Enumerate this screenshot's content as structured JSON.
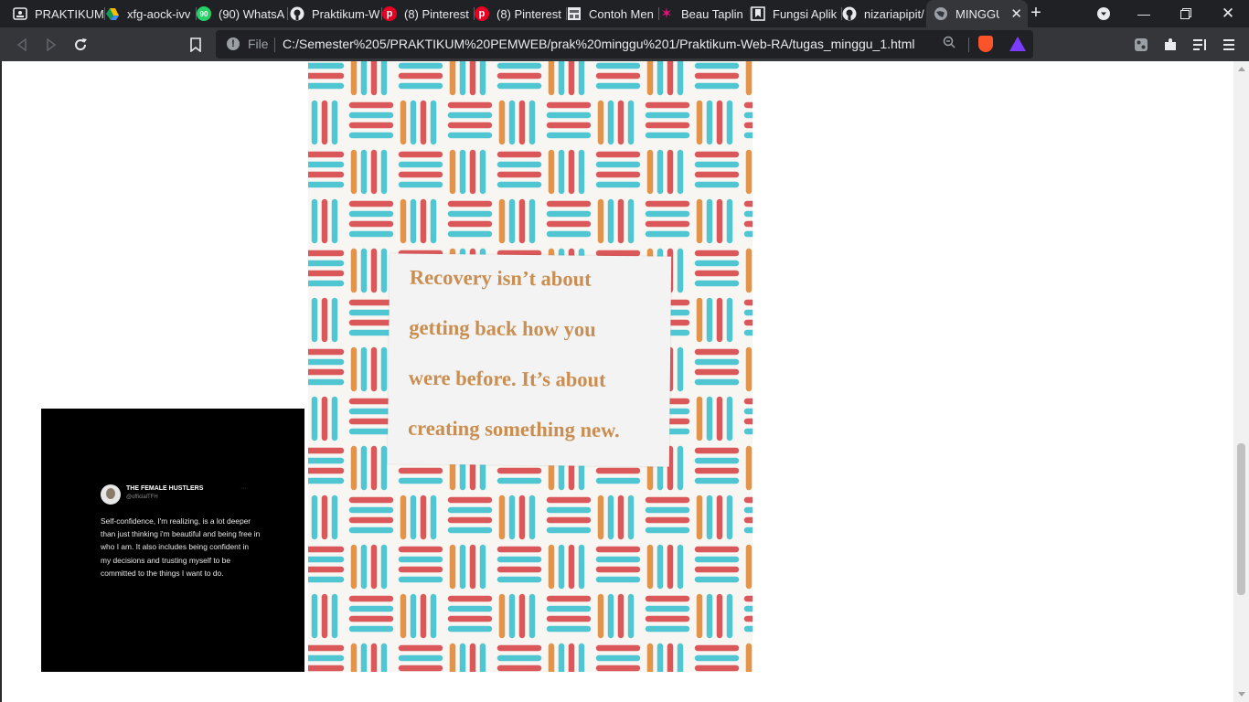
{
  "browser": {
    "tabs": [
      {
        "label": "PRAKTIKUM",
        "icon": "contact-icon"
      },
      {
        "label": "xfg-aock-ivv",
        "icon": "google-drive-icon"
      },
      {
        "label": "(90) WhatsA",
        "icon": "whatsapp-icon"
      },
      {
        "label": "Praktikum-W",
        "icon": "github-icon"
      },
      {
        "label": "(8) Pinterest",
        "icon": "pinterest-icon"
      },
      {
        "label": "(8) Pinterest",
        "icon": "pinterest-icon"
      },
      {
        "label": "Contoh Men",
        "icon": "page-icon"
      },
      {
        "label": "Beau Taplin",
        "icon": "star-icon"
      },
      {
        "label": "Fungsi Aplik",
        "icon": "bookmark-page-icon"
      },
      {
        "label": "nizariapipit/",
        "icon": "github-icon"
      },
      {
        "label": "MINGGU",
        "icon": "globe-icon",
        "active": true
      }
    ],
    "address": {
      "scheme_label": "File",
      "url": "C:/Semester%205/PRAKTIKUM%20PEMWEB/prak%20minggu%201/Praktikum-Web-RA/tugas_minggu_1.html"
    },
    "badges": {
      "whatsapp_count": "90"
    }
  },
  "page": {
    "tweet_image": {
      "account_name": "THE FEMALE HUSTLERS",
      "account_handle": "@officialTFH",
      "text": "Self-confidence, I'm realizing, is a lot deeper than just thinking i'm beautiful and being free in who I am. It also includes being confident in my decisions and trusting myself to be committed to the things I want to do."
    },
    "poster_image": {
      "lines": [
        "Recovery isn’t about",
        "getting back how you",
        "were before. It’s about",
        "creating something new."
      ],
      "colors": {
        "red": "#d9474a",
        "teal": "#3fc1d0",
        "orange": "#e08a3a"
      }
    }
  }
}
